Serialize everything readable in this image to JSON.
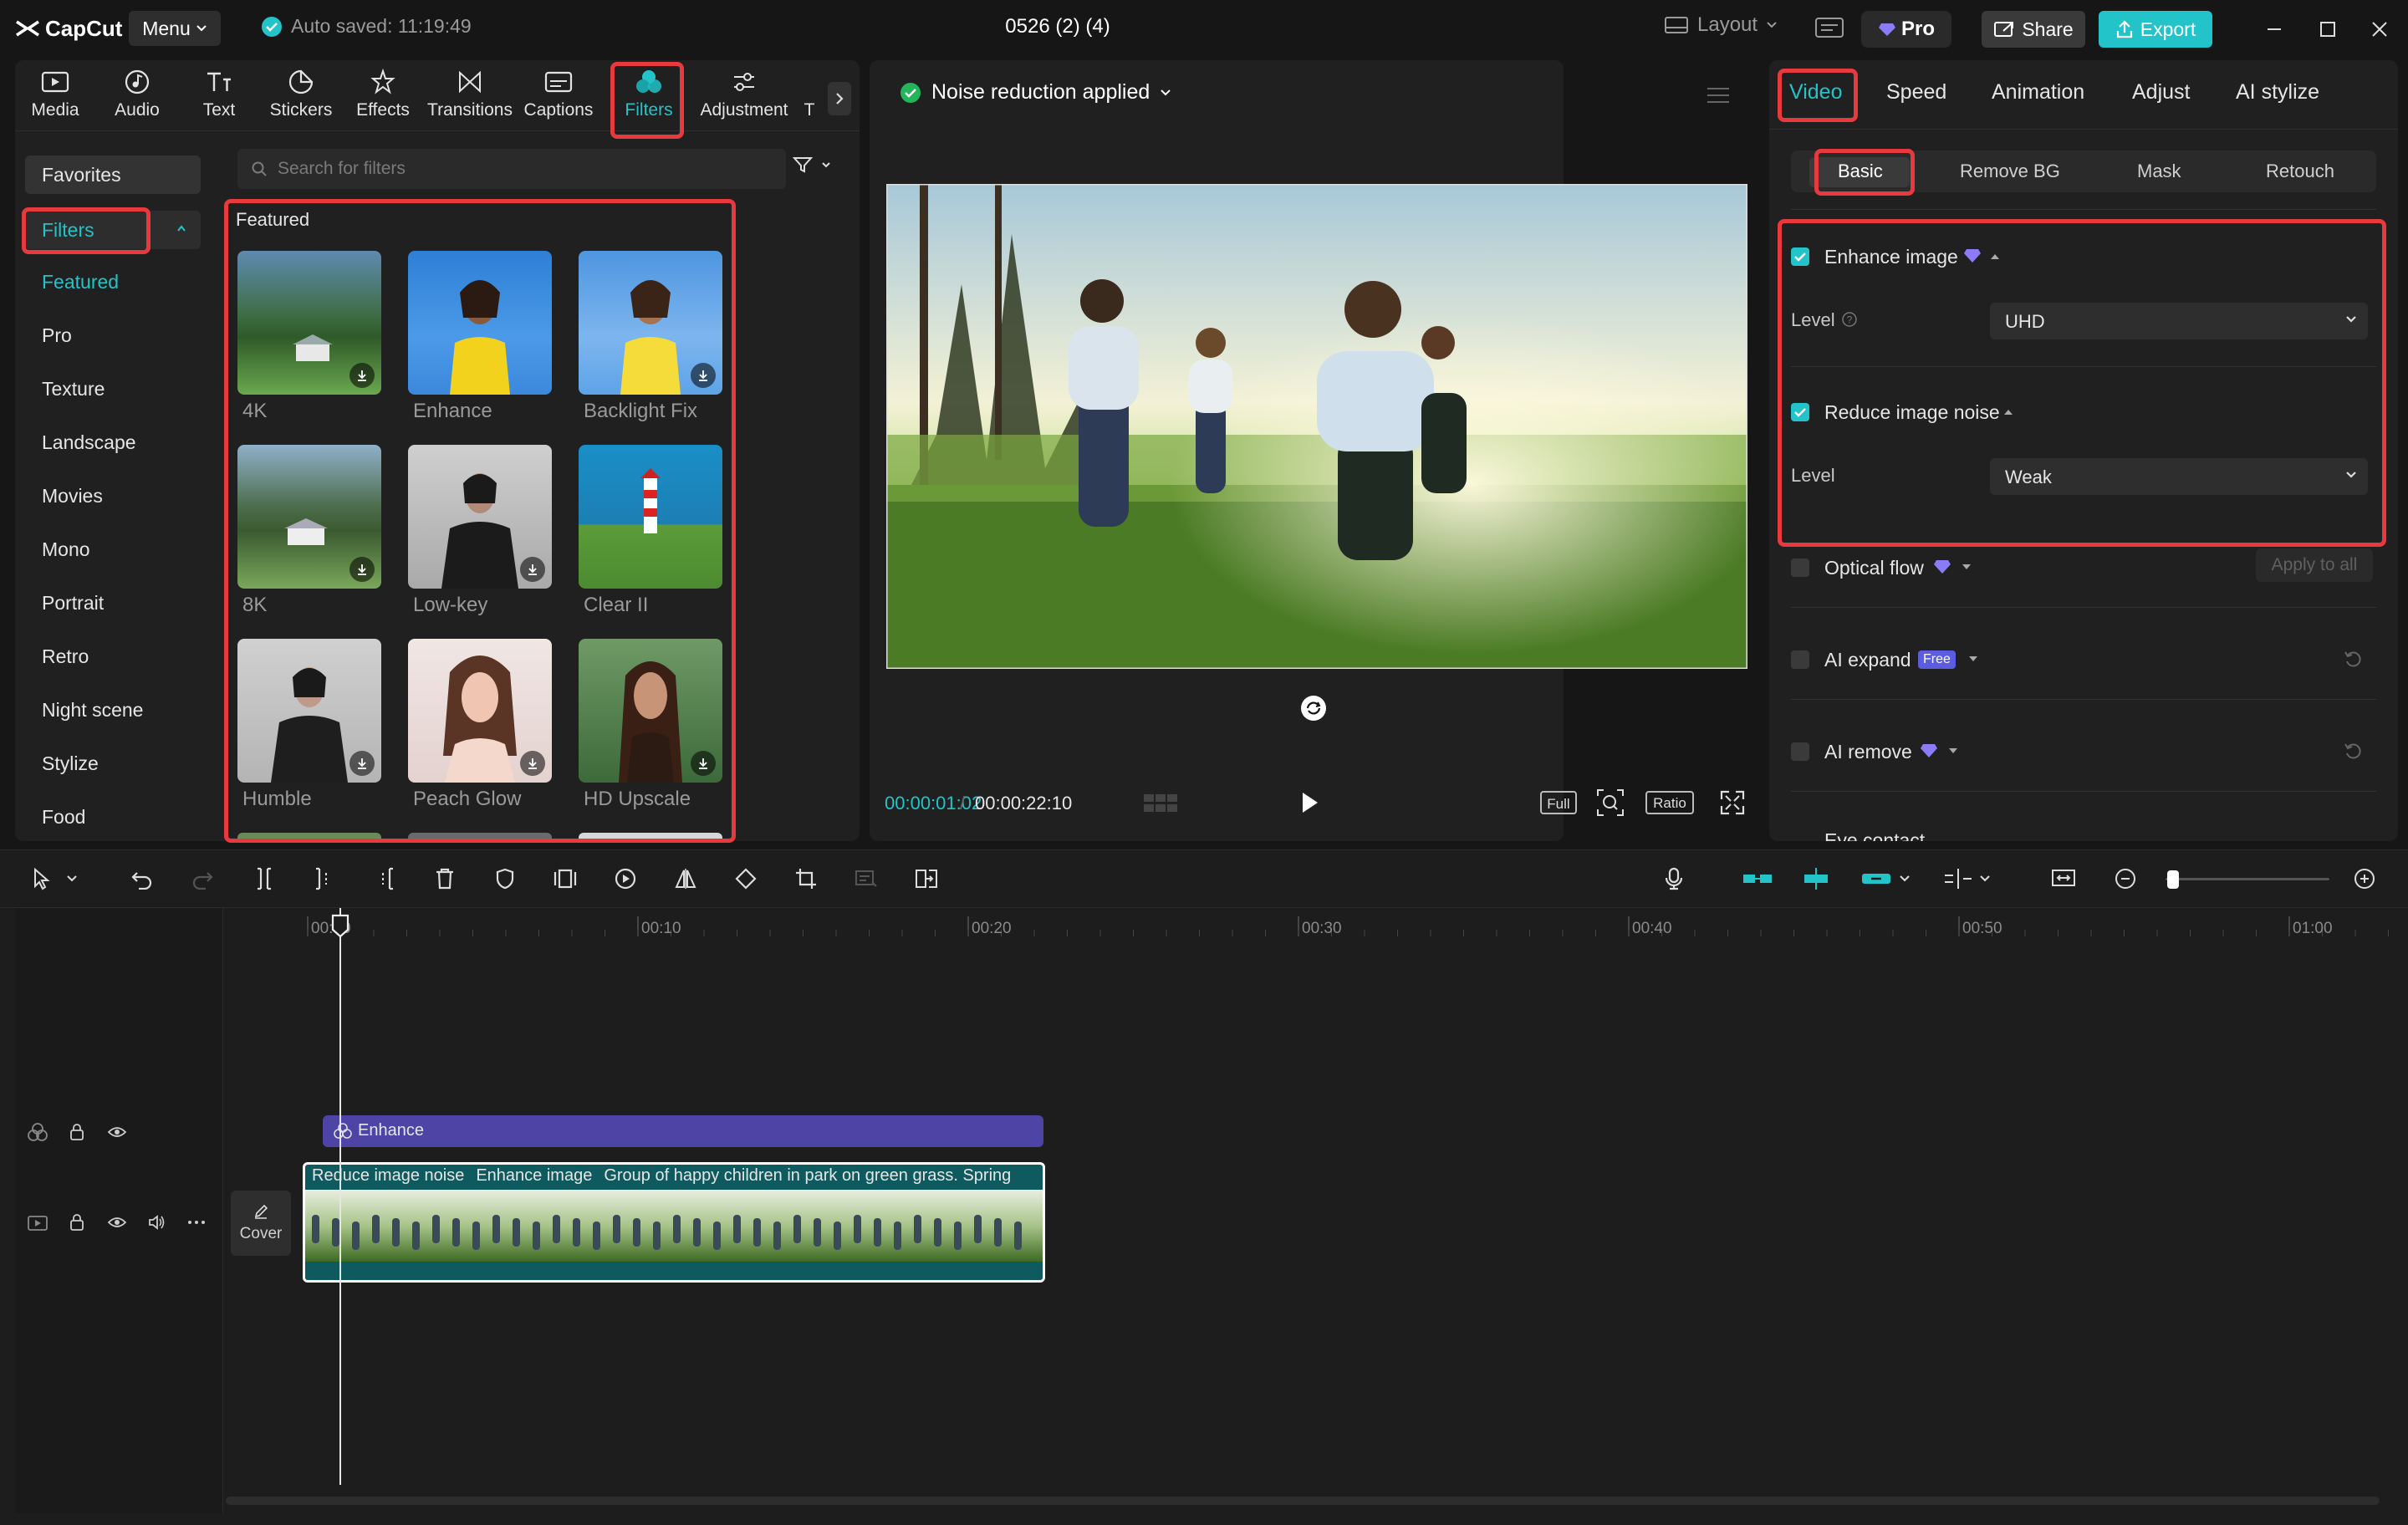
{
  "app": {
    "logo": "CapCut",
    "menu_label": "Menu",
    "autosave": "Auto saved: 11:19:49",
    "project_title": "0526 (2) (4)",
    "layout_label": "Layout",
    "pro_label": "Pro",
    "share_label": "Share",
    "export_label": "Export"
  },
  "tools": [
    "Media",
    "Audio",
    "Text",
    "Stickers",
    "Effects",
    "Transitions",
    "Captions",
    "Filters",
    "Adjustment",
    "T"
  ],
  "active_tool": "Filters",
  "sidebar": {
    "favorites": "Favorites",
    "filters": "Filters",
    "items": [
      "Featured",
      "Pro",
      "Texture",
      "Landscape",
      "Movies",
      "Mono",
      "Portrait",
      "Retro",
      "Night scene",
      "Stylize",
      "Food"
    ]
  },
  "search": {
    "placeholder": "Search for filters"
  },
  "featured": {
    "title": "Featured",
    "items": [
      "4K",
      "Enhance",
      "Backlight Fix",
      "8K",
      "Low-key",
      "Clear II",
      "Humble",
      "Peach Glow",
      "HD Upscale"
    ]
  },
  "player": {
    "status": "Noise reduction applied",
    "time_current": "00:00:01:02",
    "time_sep": "/",
    "time_total": "00:00:22:10",
    "full_label": "Full",
    "ratio_label": "Ratio"
  },
  "right_panel": {
    "tabs": [
      "Video",
      "Speed",
      "Animation",
      "Adjust",
      "AI stylize"
    ],
    "subtabs": [
      "Basic",
      "Remove BG",
      "Mask",
      "Retouch"
    ],
    "enhance_image": {
      "label": "Enhance image",
      "checked": true,
      "level_label": "Level",
      "level_value": "UHD"
    },
    "reduce_noise": {
      "label": "Reduce image noise",
      "checked": true,
      "level_label": "Level",
      "level_value": "Weak"
    },
    "optical_flow": {
      "label": "Optical flow",
      "checked": false
    },
    "apply_all": "Apply to all",
    "ai_expand": {
      "label": "AI expand",
      "badge": "Free",
      "checked": false
    },
    "ai_remove": {
      "label": "AI remove",
      "checked": false
    },
    "eye_contact": {
      "label": "Eye contact"
    }
  },
  "timeline": {
    "ruler": [
      "00:00",
      "00:10",
      "00:20",
      "00:30",
      "00:40",
      "00:50",
      "01:00"
    ],
    "effect_clip": "Enhance",
    "video_clip_labels": [
      "Reduce image noise",
      "Enhance image",
      "Group of happy children in park on green grass. Spring"
    ],
    "cover_label": "Cover"
  },
  "colors": {
    "accent": "#22c4c9",
    "highlight": "#e8393f",
    "effect_clip": "#4d44a6",
    "video_clip": "#0f5a5e"
  }
}
